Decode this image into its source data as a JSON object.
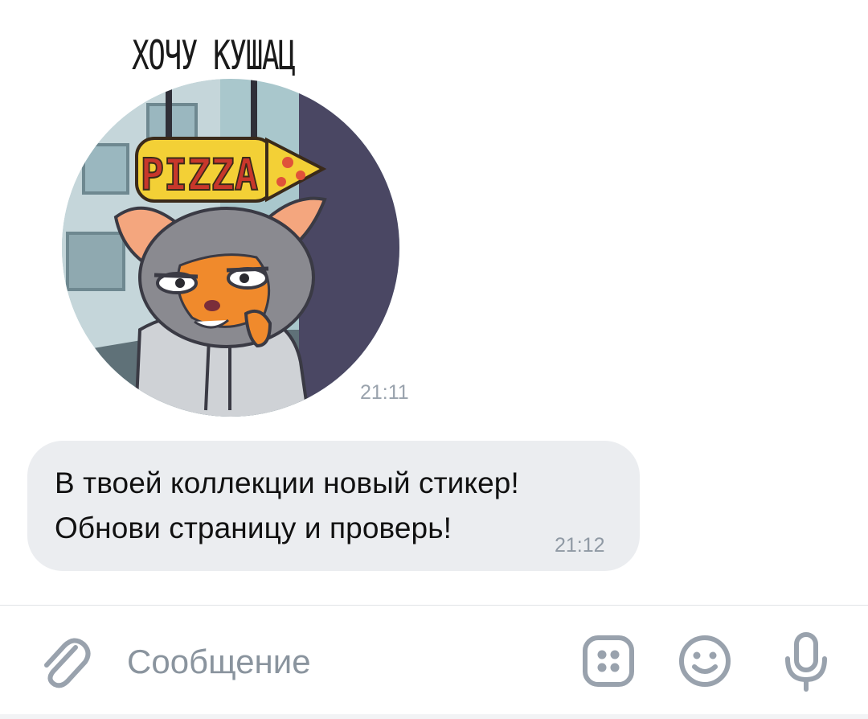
{
  "sticker_message": {
    "caption": "ХОЧУ КУШАЦ",
    "sign_text": "PIZZA",
    "time": "21:11"
  },
  "text_message": {
    "line1": "В твоей коллекции новый стикер!",
    "line2": "Обнови страницу и проверь!",
    "time": "21:12"
  },
  "composer": {
    "placeholder": "Сообщение",
    "icons": {
      "attach": "paperclip-icon",
      "stickers": "sticker-keyboard-icon",
      "emoji": "smiley-icon",
      "voice": "microphone-icon"
    }
  },
  "colors": {
    "bubble_bg": "#ebedf0",
    "meta_text": "#9aa3ad",
    "icon": "#99a2ad",
    "sticker_wall": "#4a4763",
    "sticker_fox_orange": "#f08a2c"
  }
}
